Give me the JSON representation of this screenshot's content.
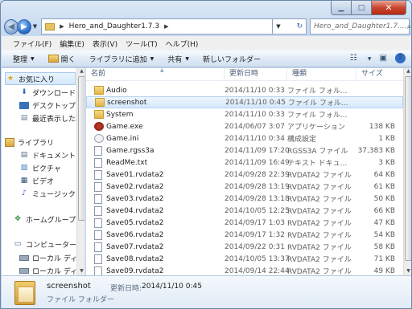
{
  "address": {
    "path": "Hero_and_Daughter1.7.3"
  },
  "search": {
    "placeholder": "Hero_and_Daughter1.7...."
  },
  "menu": [
    "ファイル(F)",
    "編集(E)",
    "表示(V)",
    "ツール(T)",
    "ヘルプ(H)"
  ],
  "toolbar": {
    "organize": "整理",
    "open": "開く",
    "add_library": "ライブラリに追加",
    "share": "共有",
    "new_folder": "新しいフォルダー"
  },
  "nav": {
    "favorites": "お気に入り",
    "downloads": "ダウンロード",
    "desktop": "デスクトップ",
    "recent": "最近表示した場",
    "libraries": "ライブラリ",
    "documents": "ドキュメント",
    "pictures": "ピクチャ",
    "videos": "ビデオ",
    "music": "ミュージック",
    "homegroup": "ホームグループ",
    "computer": "コンピューター",
    "local1": "ローカル ディス",
    "local2": "ローカル ディス"
  },
  "columns": {
    "name": "名前",
    "date": "更新日時",
    "type": "種類",
    "size": "サイズ"
  },
  "files": [
    {
      "name": "Audio",
      "date": "2014/11/10 0:33",
      "type": "ファイル フォル...",
      "size": "",
      "icon": "folder"
    },
    {
      "name": "screenshot",
      "date": "2014/11/10 0:45",
      "type": "ファイル フォル...",
      "size": "",
      "icon": "folder"
    },
    {
      "name": "System",
      "date": "2014/11/10 0:33",
      "type": "ファイル フォル...",
      "size": "",
      "icon": "folder"
    },
    {
      "name": "Game.exe",
      "date": "2014/06/07 3:07",
      "type": "アプリケーション",
      "size": "138 KB",
      "icon": "exe"
    },
    {
      "name": "Game.ini",
      "date": "2014/11/10 0:34",
      "type": "構成設定",
      "size": "1 KB",
      "icon": "ini"
    },
    {
      "name": "Game.rgss3a",
      "date": "2014/11/09 17:20",
      "type": "RGSS3A ファイル",
      "size": "37,383 KB",
      "icon": "doc"
    },
    {
      "name": "ReadMe.txt",
      "date": "2014/11/09 16:49",
      "type": "テキスト ドキュ...",
      "size": "3 KB",
      "icon": "doc"
    },
    {
      "name": "Save01.rvdata2",
      "date": "2014/09/28 22:39",
      "type": "RVDATA2 ファイル",
      "size": "64 KB",
      "icon": "doc"
    },
    {
      "name": "Save02.rvdata2",
      "date": "2014/09/28 13:19",
      "type": "RVDATA2 ファイル",
      "size": "61 KB",
      "icon": "doc"
    },
    {
      "name": "Save03.rvdata2",
      "date": "2014/09/28 13:18",
      "type": "RVDATA2 ファイル",
      "size": "50 KB",
      "icon": "doc"
    },
    {
      "name": "Save04.rvdata2",
      "date": "2014/10/05 12:25",
      "type": "RVDATA2 ファイル",
      "size": "66 KB",
      "icon": "doc"
    },
    {
      "name": "Save05.rvdata2",
      "date": "2014/09/17 1:03",
      "type": "RVDATA2 ファイル",
      "size": "47 KB",
      "icon": "doc"
    },
    {
      "name": "Save06.rvdata2",
      "date": "2014/09/17 1:32",
      "type": "RVDATA2 ファイル",
      "size": "54 KB",
      "icon": "doc"
    },
    {
      "name": "Save07.rvdata2",
      "date": "2014/09/22 0:31",
      "type": "RVDATA2 ファイル",
      "size": "58 KB",
      "icon": "doc"
    },
    {
      "name": "Save08.rvdata2",
      "date": "2014/10/05 13:37",
      "type": "RVDATA2 ファイル",
      "size": "71 KB",
      "icon": "doc"
    },
    {
      "name": "Save09.rvdata2",
      "date": "2014/09/14 22:44",
      "type": "RVDATA2 ファイル",
      "size": "49 KB",
      "icon": "doc"
    }
  ],
  "selected_index": 1,
  "details": {
    "name": "screenshot",
    "date_label": "更新日時:",
    "date_value": "2014/11/10 0:45",
    "type": "ファイル フォルダー"
  }
}
